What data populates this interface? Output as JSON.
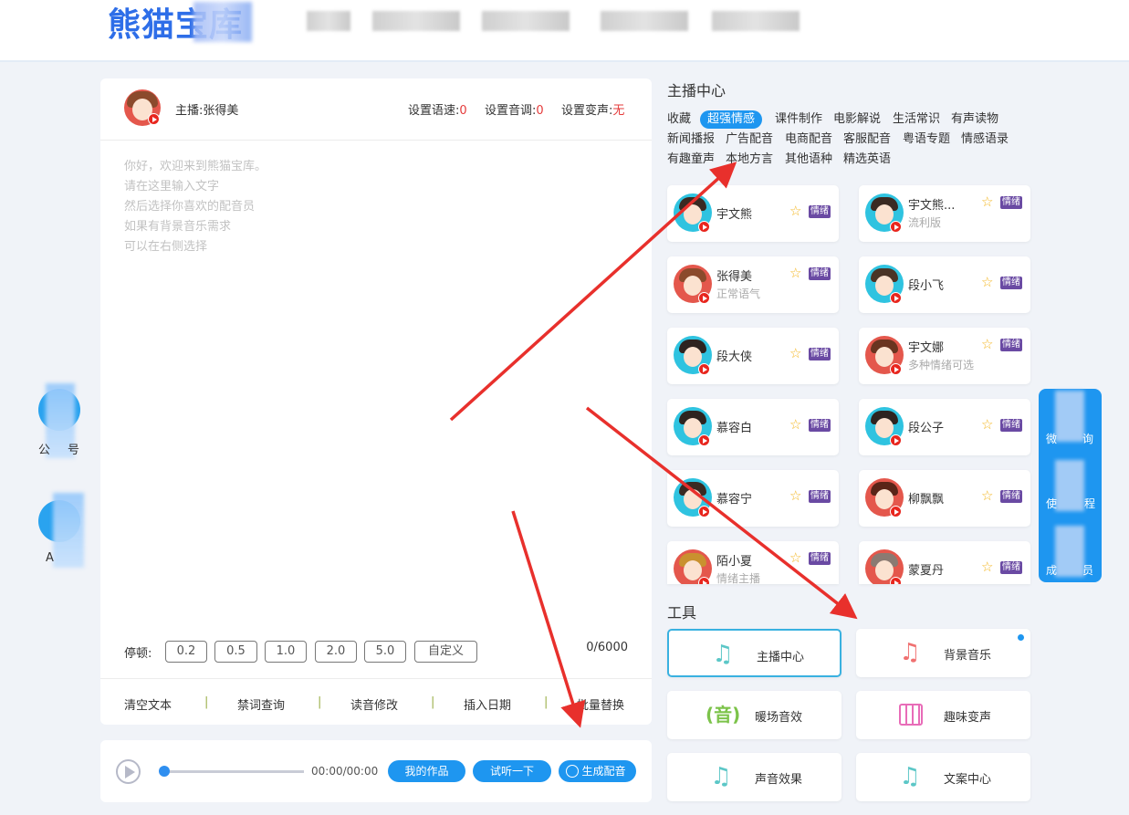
{
  "header": {
    "logo": "熊猫宝库"
  },
  "editor": {
    "anchor": "主播:张得美",
    "speed_label": "设置语速:",
    "speed_value": "0",
    "pitch_label": "设置音调:",
    "pitch_value": "0",
    "voice_change_label": "设置变声:",
    "voice_change_value": "无",
    "placeholder_lines": [
      "你好，欢迎来到熊猫宝库。",
      "请在这里输入文字",
      "然后选择你喜欢的配音员",
      "如果有背景音乐需求",
      "可以在右侧选择"
    ],
    "pause_label": "停顿:",
    "pause_options": [
      "0.2",
      "0.5",
      "1.0",
      "2.0",
      "5.0",
      "自定义"
    ],
    "counter": "0/6000",
    "tools": [
      "清空文本",
      "禁词查询",
      "读音修改",
      "插入日期",
      "批量替换"
    ]
  },
  "player": {
    "time": "00:00/00:00",
    "my_works": "我的作品",
    "preview": "试听一下",
    "generate": "生成配音"
  },
  "anchor_center": {
    "title": "主播中心",
    "categories": [
      "收藏",
      "超强情感",
      "课件制作",
      "电影解说",
      "生活常识",
      "有声读物",
      "新闻播报",
      "广告配音",
      "电商配音",
      "客服配音",
      "粤语专题",
      "情感语录",
      "有趣童声",
      "本地方言",
      "其他语种",
      "精选英语"
    ],
    "active_category": "超强情感",
    "voices": [
      {
        "name": "宇文熊",
        "sub": "",
        "tag": "情绪"
      },
      {
        "name": "宇文熊...",
        "sub": "流利版",
        "tag": "情绪"
      },
      {
        "name": "张得美",
        "sub": "正常语气",
        "tag": "情绪"
      },
      {
        "name": "段小飞",
        "sub": "",
        "tag": "情绪"
      },
      {
        "name": "段大侠",
        "sub": "",
        "tag": "情绪"
      },
      {
        "name": "宇文娜",
        "sub": "多种情绪可选",
        "tag": "情绪"
      },
      {
        "name": "慕容白",
        "sub": "",
        "tag": "情绪"
      },
      {
        "name": "段公子",
        "sub": "",
        "tag": "情绪"
      },
      {
        "name": "慕容宁",
        "sub": "",
        "tag": "情绪"
      },
      {
        "name": "柳飘飘",
        "sub": "",
        "tag": "情绪"
      },
      {
        "name": "陌小夏",
        "sub": "情绪主播",
        "tag": "情绪"
      },
      {
        "name": "蒙夏丹",
        "sub": "",
        "tag": "情绪"
      }
    ]
  },
  "tools_section": {
    "title": "工具",
    "items": [
      {
        "label": "主播中心",
        "icon": "music-note-icon"
      },
      {
        "label": "背景音乐",
        "icon": "music-note-icon"
      },
      {
        "label": "暖场音效",
        "icon": "yin-icon"
      },
      {
        "label": "趣味变声",
        "icon": "calendar-icon"
      },
      {
        "label": "声音效果",
        "icon": "music-note-icon"
      },
      {
        "label": "文案中心",
        "icon": "music-note-icon"
      }
    ]
  },
  "float_panel": {
    "items": [
      "微",
      "询",
      "使",
      "程",
      "成",
      "员"
    ]
  },
  "left_sidebar": {
    "items": [
      "公",
      "号",
      "A"
    ]
  },
  "colors": {
    "accent": "#1e96f0",
    "logo": "#2e6ee8",
    "tag": "#6a4aa3",
    "arrow": "#e8302c",
    "value_red": "#e53b3b"
  }
}
